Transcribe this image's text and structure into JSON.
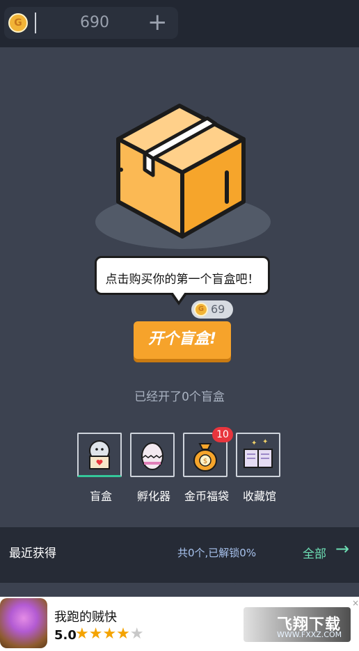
{
  "header": {
    "coin_icon_letter": "G",
    "coin_amount": "690",
    "plus_symbol": "+"
  },
  "mystery_box": {
    "prompt": "点击购买你的第一个盲盒吧！",
    "price": "69",
    "open_button_label": "开个盲盒!",
    "opened_count_text": "已经开了0个盲盒"
  },
  "tabs": [
    {
      "label": "盲盒",
      "icon": "blind-box-icon",
      "active": true
    },
    {
      "label": "孵化器",
      "icon": "egg-incubator-icon",
      "active": false
    },
    {
      "label": "金币福袋",
      "icon": "coin-bag-icon",
      "active": false,
      "badge": "10"
    },
    {
      "label": "收藏馆",
      "icon": "collection-book-icon",
      "active": false
    }
  ],
  "recent": {
    "title": "最近获得",
    "summary": "共0个,已解锁0%",
    "all_label": "全部",
    "arrow": "→"
  },
  "ad": {
    "title": "我跑的贼快",
    "rating": "5.0",
    "stars": "★★★★★",
    "watermark_title": "飞翔下载",
    "watermark_sub": "WWW.FXXZ.COM",
    "close": "×"
  },
  "colors": {
    "background": "#3c4250",
    "topbar": "#222732",
    "accent_orange": "#f6a32b",
    "accent_green": "#34c89a",
    "badge_red": "#e8353d"
  }
}
